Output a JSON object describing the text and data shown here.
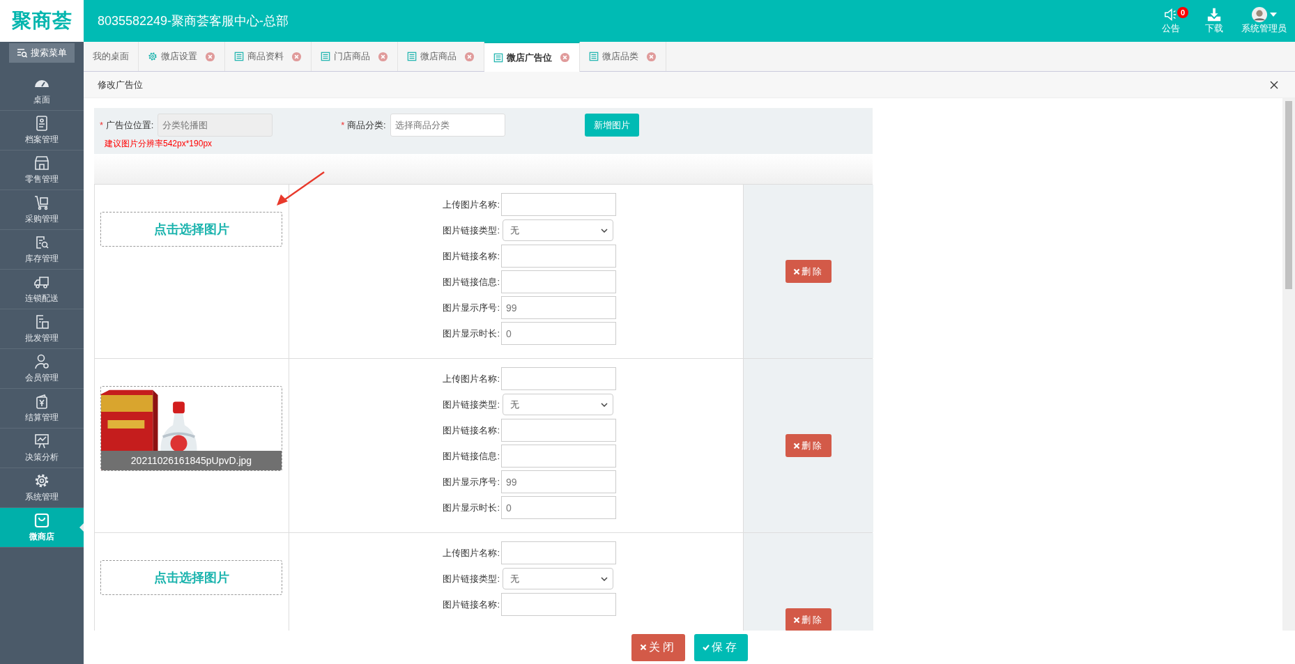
{
  "header": {
    "logo": "聚商荟",
    "title": "8035582249-聚商荟客服中心-总部",
    "actions": [
      {
        "kind": "notice",
        "label": "公告",
        "badge": "0"
      },
      {
        "kind": "download",
        "label": "下载"
      },
      {
        "kind": "user",
        "label": "系统管理员"
      }
    ]
  },
  "sidebar": {
    "search_button": "搜索菜单",
    "items": [
      {
        "label": "桌面",
        "selected": false
      },
      {
        "label": "档案管理",
        "selected": false
      },
      {
        "label": "零售管理",
        "selected": false
      },
      {
        "label": "采购管理",
        "selected": false
      },
      {
        "label": "库存管理",
        "selected": false
      },
      {
        "label": "连锁配送",
        "selected": false
      },
      {
        "label": "批发管理",
        "selected": false
      },
      {
        "label": "会员管理",
        "selected": false
      },
      {
        "label": "结算管理",
        "selected": false
      },
      {
        "label": "决策分析",
        "selected": false
      },
      {
        "label": "系统管理",
        "selected": false
      },
      {
        "label": "微商店",
        "selected": true
      }
    ]
  },
  "tabs": [
    {
      "label": "我的桌面",
      "selected": false,
      "closable": false
    },
    {
      "label": "微店设置",
      "selected": false,
      "closable": true
    },
    {
      "label": "商品资料",
      "selected": false,
      "closable": true
    },
    {
      "label": "门店商品",
      "selected": false,
      "closable": true
    },
    {
      "label": "微店商品",
      "selected": false,
      "closable": true
    },
    {
      "label": "微店广告位",
      "selected": true,
      "closable": true
    },
    {
      "label": "微店品类",
      "selected": false,
      "closable": true
    }
  ],
  "dialog": {
    "title": "修改广告位",
    "form": {
      "position": {
        "mark": "*",
        "label": "广告位位置:",
        "value": "分类轮播图"
      },
      "category": {
        "mark": "*",
        "label": "商品分类:",
        "placeholder": "选择商品分类"
      },
      "add_button": "新增图片",
      "hint": "建议图片分辨率542px*190px"
    },
    "rows": [
      {
        "choose_text": "点击选择图片",
        "delete_button": "删除",
        "fields": [
          {
            "kind": "input",
            "label": "上传图片名称:"
          },
          {
            "kind": "select",
            "label": "图片链接类型:",
            "value": "无"
          },
          {
            "kind": "input",
            "label": "图片链接名称:"
          },
          {
            "kind": "input",
            "label": "图片链接信息:"
          },
          {
            "kind": "input",
            "label": "图片显示序号:",
            "value": "99"
          },
          {
            "kind": "input",
            "label": "图片显示时长:",
            "value": "0"
          }
        ]
      },
      {
        "image": {
          "kind": "picture",
          "filename": "20211026161845pUpvD.jpg"
        },
        "delete_button": "删除",
        "fields": [
          {
            "kind": "input",
            "label": "上传图片名称:"
          },
          {
            "kind": "select",
            "label": "图片链接类型:",
            "value": "无"
          },
          {
            "kind": "input",
            "label": "图片链接名称:"
          },
          {
            "kind": "input",
            "label": "图片链接信息:"
          },
          {
            "kind": "input",
            "label": "图片显示序号:",
            "value": "99"
          },
          {
            "kind": "input",
            "label": "图片显示时长:",
            "value": "0"
          }
        ]
      },
      {
        "choose_text": "点击选择图片",
        "delete_button": "删除",
        "fields": [
          {
            "kind": "input",
            "label": "上传图片名称:"
          },
          {
            "kind": "select",
            "label": "图片链接类型:",
            "value": "无"
          },
          {
            "kind": "input",
            "label": "图片链接名称:"
          }
        ]
      }
    ],
    "buttons": [
      {
        "kind": "close",
        "label": "关闭"
      },
      {
        "kind": "save",
        "label": "保存"
      }
    ]
  }
}
